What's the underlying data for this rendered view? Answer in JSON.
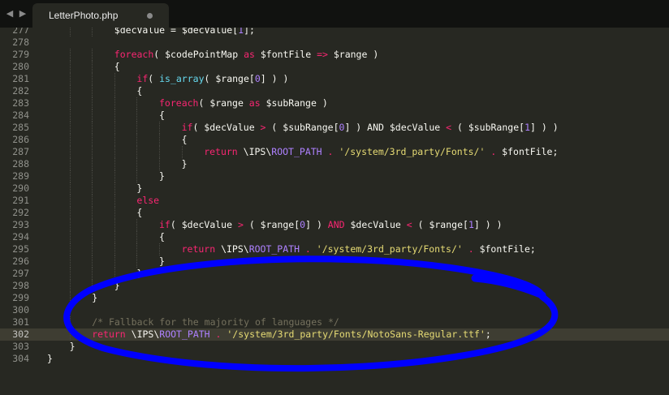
{
  "tab": {
    "title": "LetterPhoto.php",
    "back_icon": "back-arrow-icon",
    "forward_icon": "forward-arrow-icon"
  },
  "colors": {
    "keyword": "#f92672",
    "string": "#e6db74",
    "number": "#ae81ff",
    "function": "#66d9ef",
    "comment": "#75715e",
    "annotation": "#0000ff"
  },
  "code_lines": [
    {
      "number": "277",
      "indent": 3,
      "tokens": [
        [
          "var",
          "$decValue"
        ],
        [
          "op",
          " = "
        ],
        [
          "var",
          "$decValue"
        ],
        [
          "op",
          "["
        ],
        [
          "num",
          "1"
        ],
        [
          "op",
          "];"
        ]
      ]
    },
    {
      "number": "278",
      "indent": 0,
      "tokens": []
    },
    {
      "number": "279",
      "indent": 3,
      "tokens": [
        [
          "kw",
          "foreach"
        ],
        [
          "op",
          "( "
        ],
        [
          "var",
          "$codePointMap"
        ],
        [
          "kw",
          " as "
        ],
        [
          "var",
          "$fontFile"
        ],
        [
          "kw",
          " => "
        ],
        [
          "var",
          "$range"
        ],
        [
          "op",
          " )"
        ]
      ]
    },
    {
      "number": "280",
      "indent": 3,
      "tokens": [
        [
          "op",
          "{"
        ]
      ]
    },
    {
      "number": "281",
      "indent": 4,
      "tokens": [
        [
          "kw",
          "if"
        ],
        [
          "op",
          "( "
        ],
        [
          "fn",
          "is_array"
        ],
        [
          "op",
          "( "
        ],
        [
          "var",
          "$range"
        ],
        [
          "op",
          "["
        ],
        [
          "num",
          "0"
        ],
        [
          "op",
          "] ) )"
        ]
      ]
    },
    {
      "number": "282",
      "indent": 4,
      "tokens": [
        [
          "op",
          "{"
        ]
      ]
    },
    {
      "number": "283",
      "indent": 5,
      "tokens": [
        [
          "kw",
          "foreach"
        ],
        [
          "op",
          "( "
        ],
        [
          "var",
          "$range"
        ],
        [
          "kw",
          " as "
        ],
        [
          "var",
          "$subRange"
        ],
        [
          "op",
          " )"
        ]
      ]
    },
    {
      "number": "284",
      "indent": 5,
      "tokens": [
        [
          "op",
          "{"
        ]
      ]
    },
    {
      "number": "285",
      "indent": 6,
      "tokens": [
        [
          "kw",
          "if"
        ],
        [
          "op",
          "( "
        ],
        [
          "var",
          "$decValue"
        ],
        [
          "kw",
          " > "
        ],
        [
          "op",
          "( "
        ],
        [
          "var",
          "$subRange"
        ],
        [
          "op",
          "["
        ],
        [
          "num",
          "0"
        ],
        [
          "op",
          "] ) "
        ],
        [
          "op",
          "AND "
        ],
        [
          "var",
          "$decValue"
        ],
        [
          "kw",
          " < "
        ],
        [
          "op",
          "( "
        ],
        [
          "var",
          "$subRange"
        ],
        [
          "op",
          "["
        ],
        [
          "num",
          "1"
        ],
        [
          "op",
          "] ) )"
        ]
      ]
    },
    {
      "number": "286",
      "indent": 6,
      "tokens": [
        [
          "op",
          "{"
        ]
      ]
    },
    {
      "number": "287",
      "indent": 7,
      "tokens": [
        [
          "kw",
          "return "
        ],
        [
          "op",
          "\\IPS\\"
        ],
        [
          "const",
          "ROOT_PATH"
        ],
        [
          "kw",
          " . "
        ],
        [
          "str",
          "'/system/3rd_party/Fonts/'"
        ],
        [
          "kw",
          " . "
        ],
        [
          "var",
          "$fontFile"
        ],
        [
          "op",
          ";"
        ]
      ]
    },
    {
      "number": "288",
      "indent": 6,
      "tokens": [
        [
          "op",
          "}"
        ]
      ]
    },
    {
      "number": "289",
      "indent": 5,
      "tokens": [
        [
          "op",
          "}"
        ]
      ]
    },
    {
      "number": "290",
      "indent": 4,
      "tokens": [
        [
          "op",
          "}"
        ]
      ]
    },
    {
      "number": "291",
      "indent": 4,
      "tokens": [
        [
          "kw",
          "else"
        ]
      ]
    },
    {
      "number": "292",
      "indent": 4,
      "tokens": [
        [
          "op",
          "{"
        ]
      ]
    },
    {
      "number": "293",
      "indent": 5,
      "tokens": [
        [
          "kw",
          "if"
        ],
        [
          "op",
          "( "
        ],
        [
          "var",
          "$decValue"
        ],
        [
          "kw",
          " > "
        ],
        [
          "op",
          "( "
        ],
        [
          "var",
          "$range"
        ],
        [
          "op",
          "["
        ],
        [
          "num",
          "0"
        ],
        [
          "op",
          "] ) "
        ],
        [
          "kw",
          "AND "
        ],
        [
          "var",
          "$decValue"
        ],
        [
          "kw",
          " < "
        ],
        [
          "op",
          "( "
        ],
        [
          "var",
          "$range"
        ],
        [
          "op",
          "["
        ],
        [
          "num",
          "1"
        ],
        [
          "op",
          "] ) )"
        ]
      ]
    },
    {
      "number": "294",
      "indent": 5,
      "tokens": [
        [
          "op",
          "{"
        ]
      ]
    },
    {
      "number": "295",
      "indent": 6,
      "tokens": [
        [
          "kw",
          "return "
        ],
        [
          "op",
          "\\IPS\\"
        ],
        [
          "const",
          "ROOT_PATH"
        ],
        [
          "kw",
          " . "
        ],
        [
          "str",
          "'/system/3rd_party/Fonts/'"
        ],
        [
          "kw",
          " . "
        ],
        [
          "var",
          "$fontFile"
        ],
        [
          "op",
          ";"
        ]
      ]
    },
    {
      "number": "296",
      "indent": 5,
      "tokens": [
        [
          "op",
          "}"
        ]
      ]
    },
    {
      "number": "297",
      "indent": 4,
      "tokens": [
        [
          "op",
          "}"
        ]
      ]
    },
    {
      "number": "298",
      "indent": 3,
      "tokens": [
        [
          "op",
          "}"
        ]
      ]
    },
    {
      "number": "299",
      "indent": 2,
      "tokens": [
        [
          "op",
          "}"
        ]
      ]
    },
    {
      "number": "300",
      "indent": 0,
      "tokens": []
    },
    {
      "number": "301",
      "indent": 2,
      "tokens": [
        [
          "cm",
          "/* Fallback for the majority of languages */"
        ]
      ]
    },
    {
      "number": "302",
      "indent": 2,
      "current": true,
      "tokens": [
        [
          "kw",
          "return "
        ],
        [
          "op",
          "\\IPS\\"
        ],
        [
          "const",
          "ROOT_PATH"
        ],
        [
          "kw",
          " . "
        ],
        [
          "str",
          "'/system/3rd_party/Fonts/NotoSans-Regular.ttf'"
        ],
        [
          "op",
          ";"
        ]
      ]
    },
    {
      "number": "303",
      "indent": 1,
      "tokens": [
        [
          "op",
          "}"
        ]
      ]
    },
    {
      "number": "304",
      "indent": 0,
      "tokens": [
        [
          "op",
          "}"
        ]
      ]
    }
  ]
}
